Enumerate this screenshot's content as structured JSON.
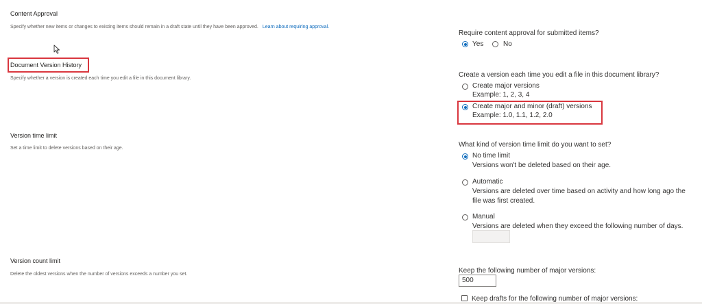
{
  "content_approval": {
    "title": "Content Approval",
    "description": "Specify whether new items or changes to existing items should remain in a draft state until they have been approved.",
    "link": "Learn about requiring approval.",
    "question": "Require content approval for submitted items?",
    "yes_label": "Yes",
    "no_label": "No",
    "selected": "Yes"
  },
  "version_history": {
    "title": "Document Version History",
    "description": "Specify whether a version is created each time you edit a file in this document library.",
    "question": "Create a version each time you edit a file in this document library?",
    "options": [
      {
        "label": "Create major versions",
        "example": "Example: 1, 2, 3, 4",
        "selected": false
      },
      {
        "label": "Create major and minor (draft) versions",
        "example": "Example: 1.0, 1.1, 1.2, 2.0",
        "selected": true
      }
    ]
  },
  "time_limit": {
    "title": "Version time limit",
    "description": "Set a time limit to delete versions based on their age.",
    "question": "What kind of version time limit do you want to set?",
    "options": [
      {
        "label": "No time limit",
        "desc": "Versions won't be deleted based on their age.",
        "selected": true
      },
      {
        "label": "Automatic",
        "desc1": "Versions are deleted over time based on activity and how long ago the",
        "desc2": "file was first created.",
        "selected": false
      },
      {
        "label": "Manual",
        "desc": "Versions are deleted when they exceed the following number of days.",
        "selected": false
      }
    ],
    "days_value": ""
  },
  "count_limit": {
    "title": "Version count limit",
    "description": "Delete the oldest versions when the number of versions exceeds a number you set.",
    "major_label": "Keep the following number of major versions:",
    "major_value": "500",
    "drafts_label": "Keep drafts for the following number of major versions:"
  },
  "colors": {
    "accent": "#0f6cbd",
    "highlight": "#d9363e"
  }
}
